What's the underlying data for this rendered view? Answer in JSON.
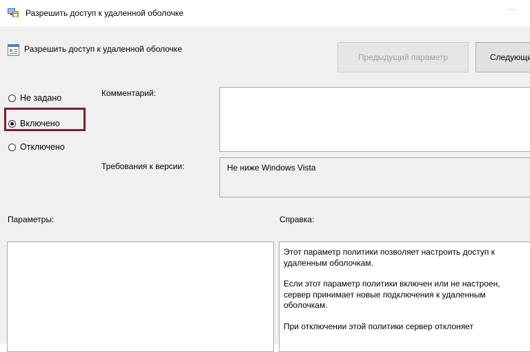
{
  "window": {
    "title": "Разрешить доступ к удаленной оболочке"
  },
  "header": {
    "title": "Разрешить доступ к удаленной оболочке",
    "prev_button": "Предыдущий параметр",
    "next_button": "Следующий параметр"
  },
  "state": {
    "options": [
      "Не задано",
      "Включено",
      "Отключено"
    ],
    "selected": "Включено"
  },
  "labels": {
    "comment": "Комментарий:",
    "version": "Требования к версии:",
    "params": "Параметры:",
    "help": "Справка:"
  },
  "version_value": "Не ниже Windows Vista",
  "help_text": [
    "Этот параметр политики позволяет настроить доступ к\nудаленным оболочкам.",
    "Если этот параметр политики включен или не настроен,\nсервер принимает новые подключения к удаленным\nоболочкам.",
    "При отключении этой политики сервер отклоняет"
  ],
  "colors": {
    "focus_border": "#7b1f2b",
    "background": "#f0f0f0"
  }
}
